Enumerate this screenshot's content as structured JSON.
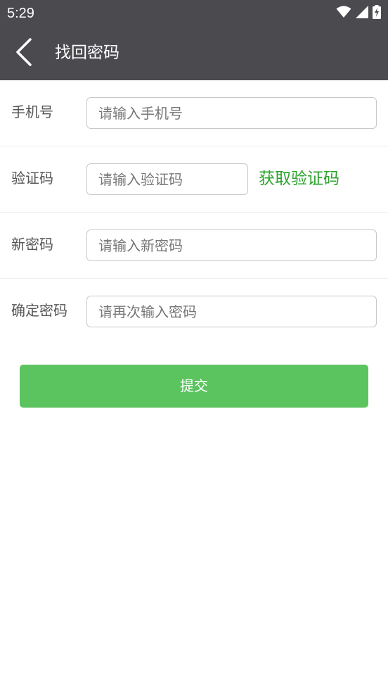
{
  "status_bar": {
    "time": "5:29",
    "icons": [
      "wifi-icon",
      "cellular-signal-icon",
      "battery-charging-icon"
    ]
  },
  "app_bar": {
    "back_icon": "back-chevron-icon",
    "title": "找回密码"
  },
  "form": {
    "phone": {
      "label": "手机号",
      "placeholder": "请输入手机号",
      "value": ""
    },
    "code": {
      "label": "验证码",
      "placeholder": "请输入验证码",
      "value": "",
      "get_code_label": "获取验证码"
    },
    "new_password": {
      "label": "新密码",
      "placeholder": "请输入新密码",
      "value": ""
    },
    "confirm_password": {
      "label": "确定密码",
      "placeholder": "请再次输入密码",
      "value": ""
    }
  },
  "submit": {
    "label": "提交"
  },
  "colors": {
    "bar_background": "#4a4a4f",
    "accent_green": "#2aa32a",
    "submit_green": "#5cc45f",
    "input_border": "#c8c8c8"
  }
}
